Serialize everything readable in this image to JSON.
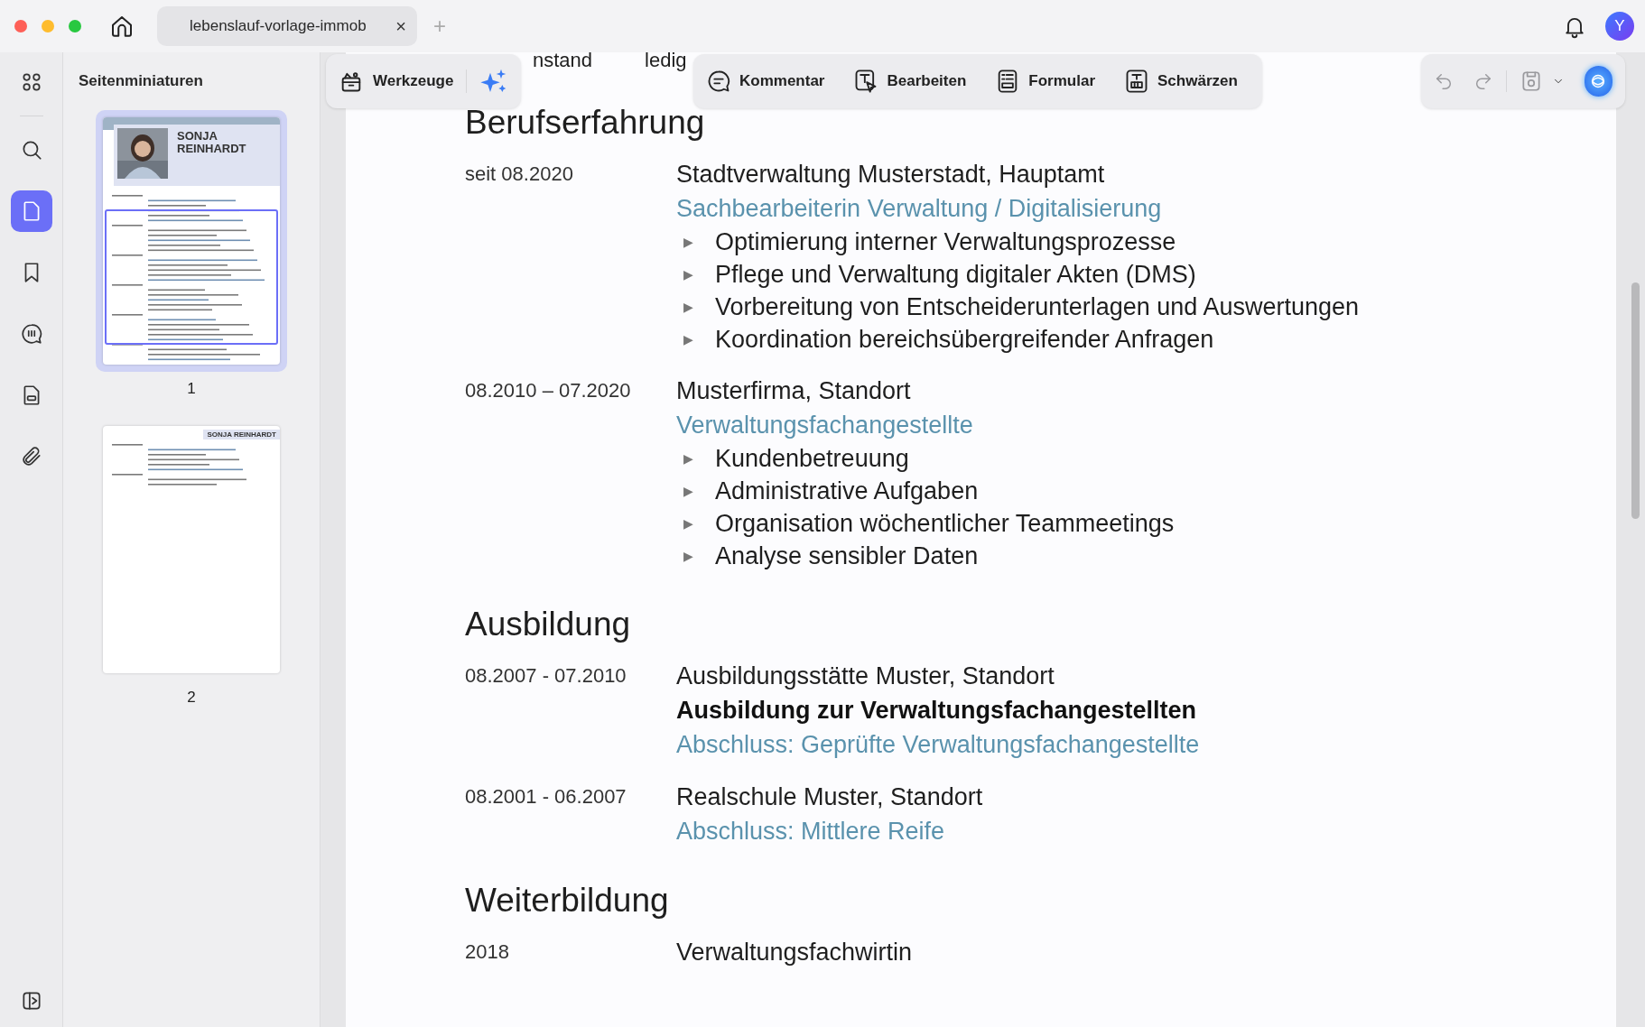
{
  "tab": {
    "title": "lebenslauf-vorlage-immob",
    "close": "×",
    "new_tab": "+"
  },
  "account": {
    "initial": "Y"
  },
  "rail": [
    {
      "kind": "grid",
      "selected": false
    },
    {
      "kind": "search",
      "selected": false
    },
    {
      "kind": "pages",
      "selected": true
    },
    {
      "kind": "bookmark",
      "selected": false
    },
    {
      "kind": "comment",
      "selected": false
    },
    {
      "kind": "form",
      "selected": false
    },
    {
      "kind": "attachment",
      "selected": false
    }
  ],
  "panel": {
    "title": "Seitenminiaturen",
    "thumbnails": [
      {
        "label": "1",
        "selected": true,
        "heading": "SONJA REINHARDT",
        "kind": "cover"
      },
      {
        "label": "2",
        "selected": false,
        "heading": "SONJA REINHARDT",
        "kind": "plain"
      }
    ]
  },
  "toolbar": {
    "main": "Werkzeuge",
    "tools": [
      {
        "kind": "comment",
        "label": "Kommentar"
      },
      {
        "kind": "edit",
        "label": "Bearbeiten"
      },
      {
        "kind": "form",
        "label": "Formular"
      },
      {
        "kind": "redact",
        "label": "Schwärzen"
      }
    ]
  },
  "document": {
    "peek": [
      "nstand",
      "ledig"
    ],
    "sections": [
      {
        "title": "Berufserfahrung",
        "entries": [
          {
            "date": "seit 08.2020",
            "lines": [
              {
                "kind": "org",
                "text": "Stadtverwaltung Musterstadt, Hauptamt"
              },
              {
                "kind": "role",
                "text": "Sachbearbeiterin Verwaltung / Digitalisierung"
              }
            ],
            "bullets": [
              {
                "marker": "▶",
                "text": "Optimierung interner Verwaltungsprozesse"
              },
              {
                "marker": "▶",
                "text": "Pflege und Verwaltung digitaler Akten (DMS)"
              },
              {
                "marker": "▶",
                "text": "Vorbereitung von Entscheiderunterlagen und Auswertungen"
              },
              {
                "marker": "▶",
                "text": "Koordination bereichsübergreifender Anfragen"
              }
            ]
          },
          {
            "date": "08.2010 – 07.2020",
            "lines": [
              {
                "kind": "org",
                "text": "Musterfirma, Standort"
              },
              {
                "kind": "role",
                "text": "Verwaltungsfachangestellte"
              }
            ],
            "bullets": [
              {
                "marker": "▶",
                "text": "Kundenbetreuung"
              },
              {
                "marker": "▶",
                "text": "Administrative Aufgaben"
              },
              {
                "marker": "▶",
                "text": "Organisation wöchentlicher Teammeetings"
              },
              {
                "marker": "▶",
                "text": "Analyse sensibler Daten"
              }
            ]
          }
        ]
      },
      {
        "title": "Ausbildung",
        "entries": [
          {
            "date": "08.2007 - 07.2010",
            "lines": [
              {
                "kind": "org",
                "text": "Ausbildungsstätte Muster, Standort"
              },
              {
                "kind": "bold",
                "text": "Ausbildung zur Verwaltungsfachangestellten"
              },
              {
                "kind": "role",
                "text": "Abschluss: Geprüfte Verwaltungsfachangestellte"
              }
            ]
          },
          {
            "date": "08.2001 - 06.2007",
            "lines": [
              {
                "kind": "org",
                "text": "Realschule Muster, Standort"
              },
              {
                "kind": "role",
                "text": "Abschluss: Mittlere Reife"
              }
            ]
          }
        ]
      },
      {
        "title": "Weiterbildung",
        "entries": [
          {
            "date": "2018",
            "lines": [
              {
                "kind": "org",
                "text": "Verwaltungsfachwirtin"
              }
            ]
          }
        ]
      }
    ]
  }
}
